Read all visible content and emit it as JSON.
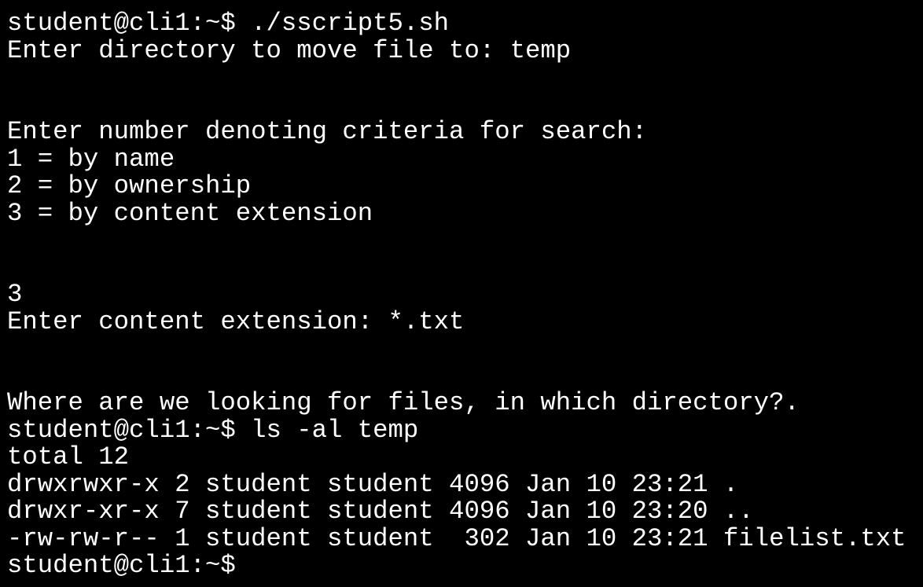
{
  "terminal": {
    "lines": [
      "student@cli1:~$ ./sscript5.sh",
      "Enter directory to move file to: temp",
      "",
      "",
      "Enter number denoting criteria for search:",
      "1 = by name",
      "2 = by ownership",
      "3 = by content extension",
      "",
      "",
      "3",
      "Enter content extension: *.txt",
      "",
      "",
      "Where are we looking for files, in which directory?.",
      "student@cli1:~$ ls -al temp",
      "total 12",
      "drwxrwxr-x 2 student student 4096 Jan 10 23:21 .",
      "drwxr-xr-x 7 student student 4096 Jan 10 23:20 ..",
      "-rw-rw-r-- 1 student student  302 Jan 10 23:21 filelist.txt",
      "student@cli1:~$"
    ]
  },
  "colors": {
    "background": "#000000",
    "foreground": "#ffffff"
  }
}
